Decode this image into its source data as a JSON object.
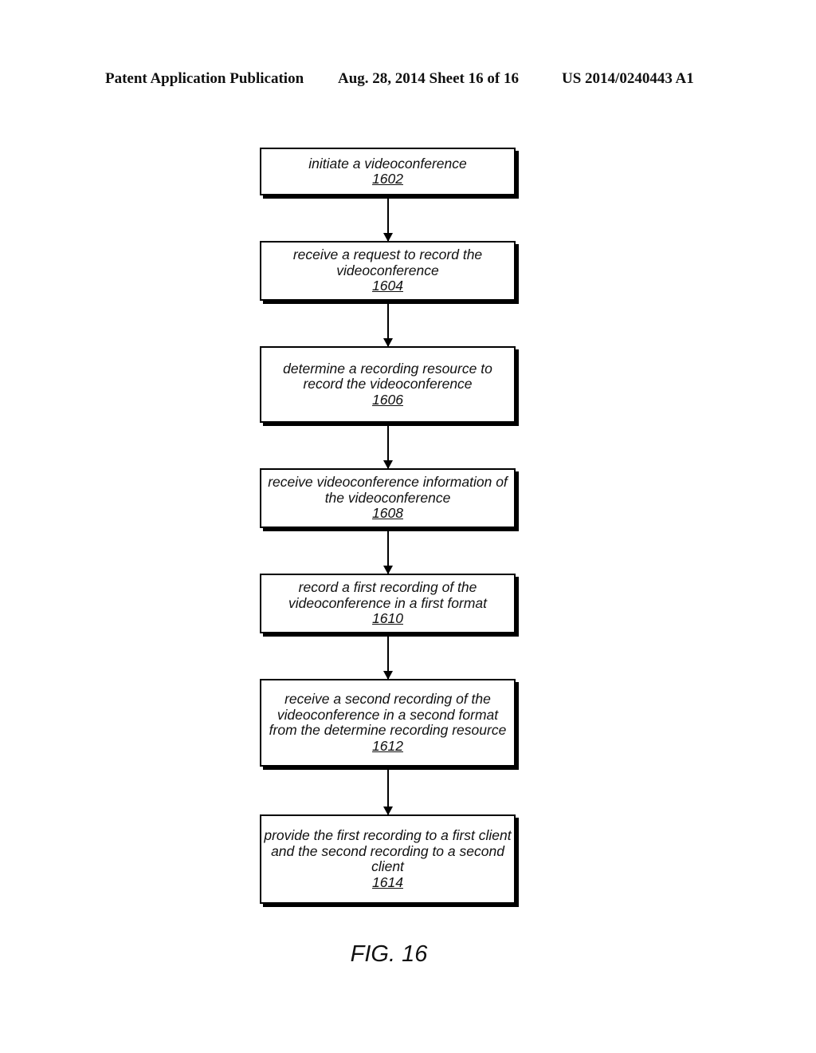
{
  "header": {
    "left": "Patent Application Publication",
    "middle": "Aug. 28, 2014  Sheet 16 of 16",
    "right": "US 2014/0240443 A1"
  },
  "flowchart": {
    "steps": [
      {
        "label": "initiate a videoconference",
        "ref": "1602"
      },
      {
        "label": "receive a request to record the videoconference",
        "ref": "1604"
      },
      {
        "label": "determine a recording resource to record the videoconference",
        "ref": "1606"
      },
      {
        "label": "receive videoconference information of the videoconference",
        "ref": "1608"
      },
      {
        "label": "record a first recording of the videoconference in a first format",
        "ref": "1610"
      },
      {
        "label": "receive a second recording of the videoconference in a second format from the determine recording resource",
        "ref": "1612"
      },
      {
        "label": "provide the first recording to a first client and the second recording to a second client",
        "ref": "1614"
      }
    ],
    "edges": [
      {
        "from": "1602",
        "to": "1604"
      },
      {
        "from": "1604",
        "to": "1606"
      },
      {
        "from": "1606",
        "to": "1608"
      },
      {
        "from": "1608",
        "to": "1610"
      },
      {
        "from": "1610",
        "to": "1612"
      },
      {
        "from": "1612",
        "to": "1614"
      }
    ]
  },
  "figure_label": "FIG. 16"
}
